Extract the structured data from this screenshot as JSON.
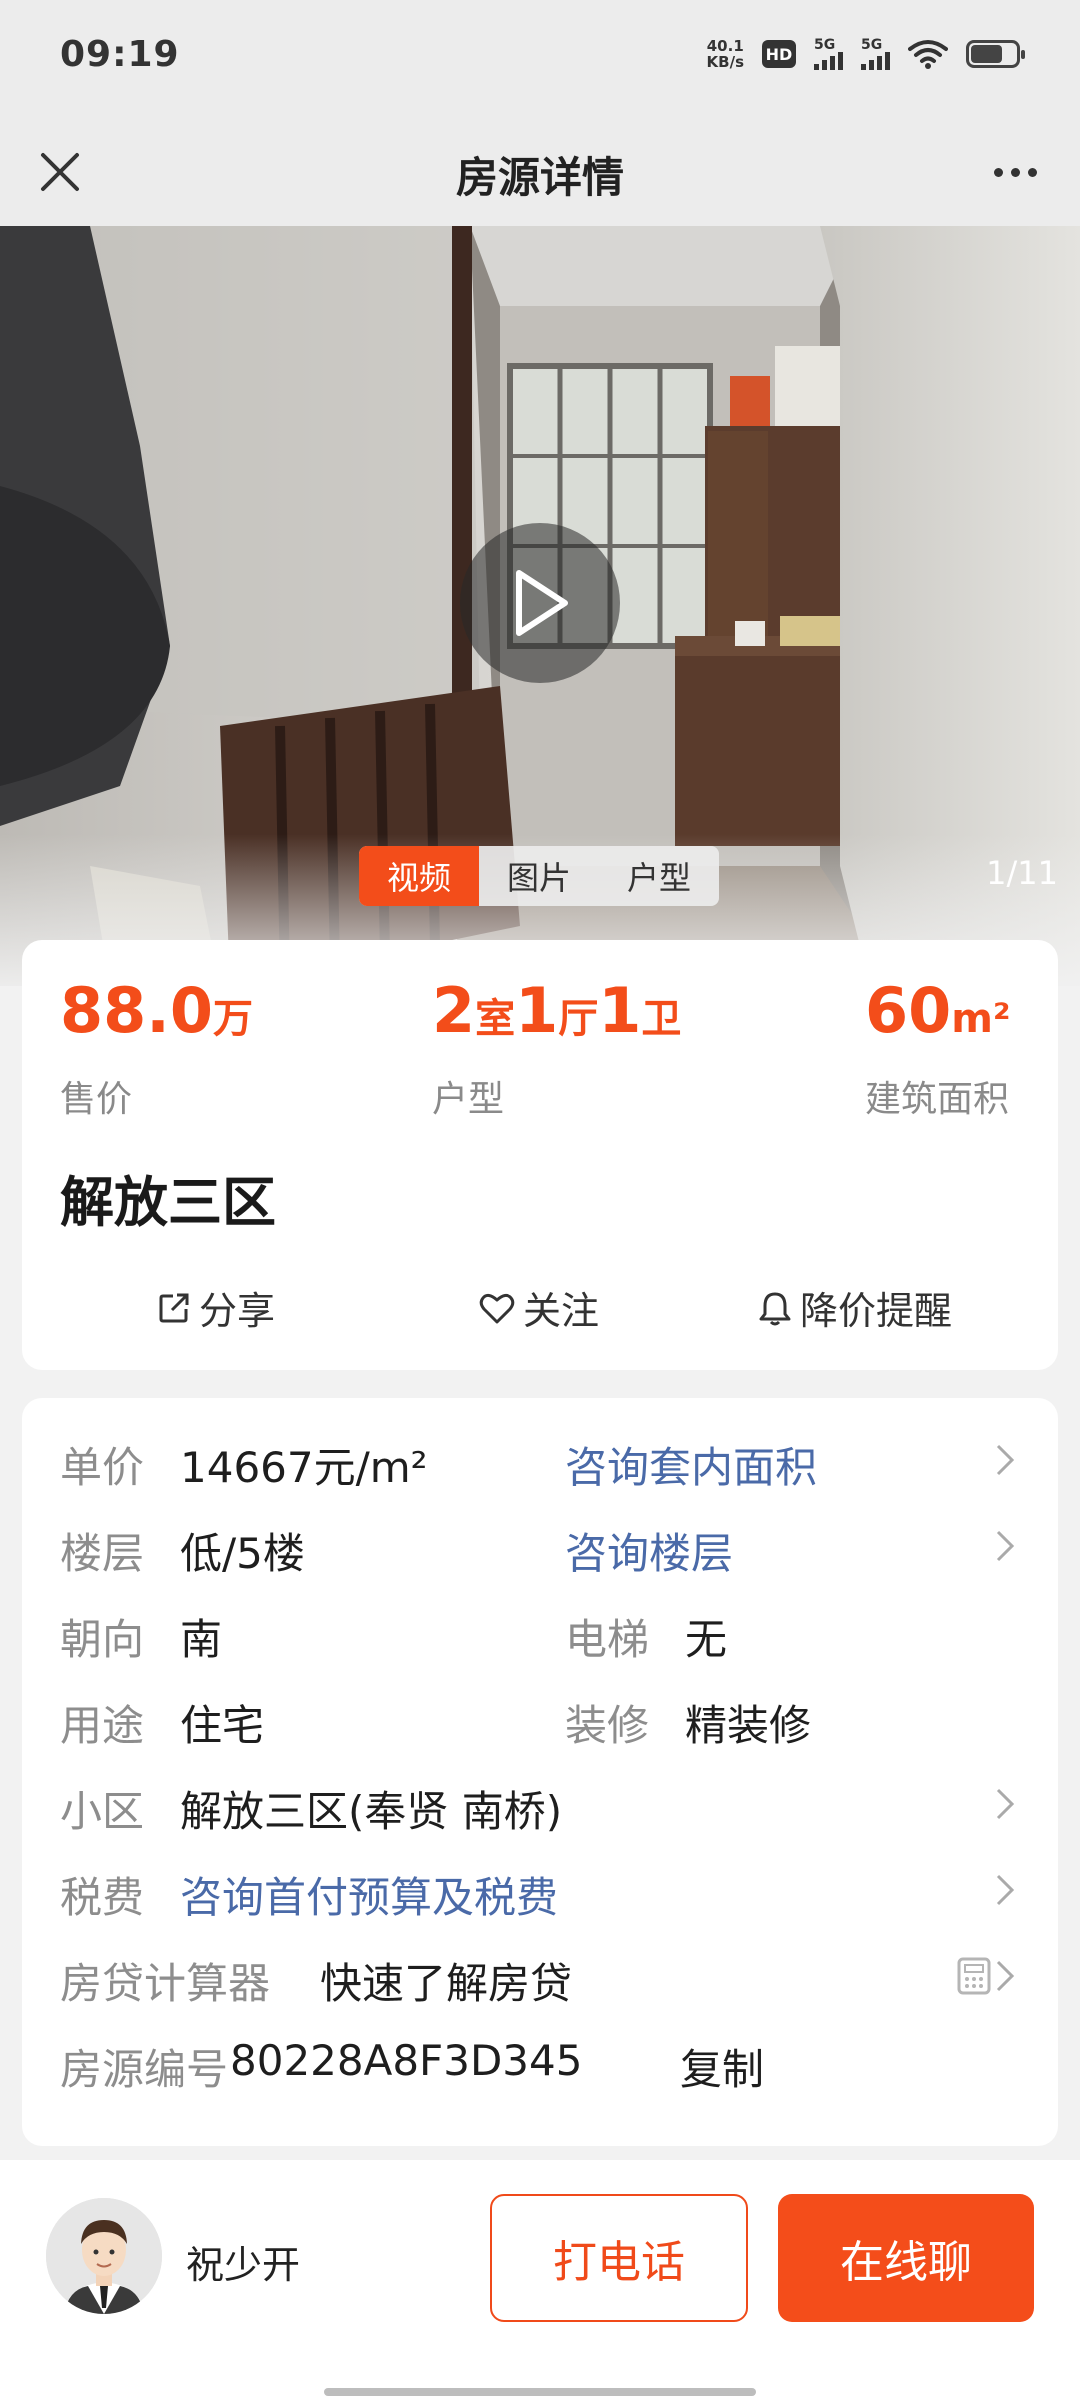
{
  "status_bar": {
    "time": "09:19",
    "net_speed_value": "40.1",
    "net_speed_unit": "KB/s",
    "hd_label": "HD",
    "sim1_label": "5G",
    "sim2_label": "5G",
    "battery_percent": 70
  },
  "nav": {
    "title": "房源详情",
    "close_icon": "close-icon",
    "more_icon": "more-icon"
  },
  "media": {
    "tabs": [
      "视频",
      "图片",
      "户型"
    ],
    "active_tab": "视频",
    "counter": "1/11"
  },
  "summary": {
    "price": {
      "value": "88.0",
      "unit": "万",
      "label": "售价"
    },
    "layout": {
      "rooms": "2",
      "rooms_unit": "室",
      "halls": "1",
      "halls_unit": "厅",
      "baths": "1",
      "baths_unit": "卫",
      "label": "户型"
    },
    "area": {
      "value": "60",
      "unit": "m²",
      "label": "建筑面积"
    },
    "community": "解放三区",
    "actions": {
      "share": "分享",
      "follow": "关注",
      "price_alert": "降价提醒"
    }
  },
  "details": {
    "unit_price_label": "单价",
    "unit_price_value": "14667元/m²",
    "inner_area_link": "咨询套内面积",
    "floor_label": "楼层",
    "floor_value": "低/5楼",
    "floor_link": "咨询楼层",
    "orientation_label": "朝向",
    "orientation_value": "南",
    "elevator_label": "电梯",
    "elevator_value": "无",
    "usage_label": "用途",
    "usage_value": "住宅",
    "decoration_label": "装修",
    "decoration_value": "精装修",
    "estate_label": "小区",
    "estate_value": "解放三区(奉贤  南桥)",
    "tax_label": "税费",
    "tax_link": "咨询首付预算及税费",
    "mortgage_label": "房贷计算器",
    "mortgage_value": "快速了解房贷",
    "listing_id_label": "房源编号",
    "listing_id_value": "80228A8F3D345",
    "copy_label": "复制"
  },
  "bottom_bar": {
    "agent_name": "祝少开",
    "call_label": "打电话",
    "chat_label": "在线聊"
  },
  "colors": {
    "accent": "#f34d1a",
    "link": "#4a6aa8",
    "label_gray": "#8d8d8d"
  }
}
